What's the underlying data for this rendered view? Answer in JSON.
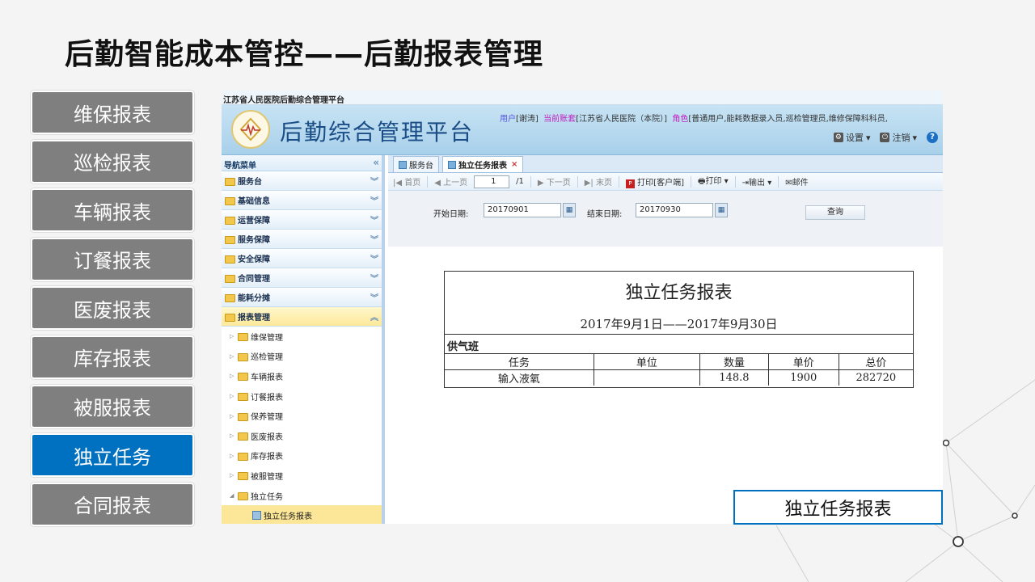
{
  "page": {
    "title": "后勤智能成本管控——后勤报表管理",
    "caption": "独立任务报表"
  },
  "slide_nav": [
    {
      "label": "维保报表",
      "active": false
    },
    {
      "label": "巡检报表",
      "active": false
    },
    {
      "label": "车辆报表",
      "active": false
    },
    {
      "label": "订餐报表",
      "active": false
    },
    {
      "label": "医废报表",
      "active": false
    },
    {
      "label": "库存报表",
      "active": false
    },
    {
      "label": "被服报表",
      "active": false
    },
    {
      "label": "独立任务",
      "active": true
    },
    {
      "label": "合同报表",
      "active": false
    }
  ],
  "app": {
    "topline": "江苏省人民医院后勤综合管理平台",
    "name": "后勤综合管理平台",
    "user": {
      "user_key": "用户",
      "user_val": "[谢涛]",
      "account_key": "当前账套",
      "account_val": "[江苏省人民医院（本院）]",
      "role_key": "角色",
      "role_val": "[普通用户,能耗数据录入员,巡检管理员,维修保障科科员,"
    },
    "tools": {
      "settings": "设置",
      "logout": "注销",
      "help": "?"
    },
    "sidebar": {
      "title": "导航菜单",
      "menus": [
        {
          "label": "服务台",
          "active": false
        },
        {
          "label": "基础信息",
          "active": false
        },
        {
          "label": "运营保障",
          "active": false
        },
        {
          "label": "服务保障",
          "active": false
        },
        {
          "label": "安全保障",
          "active": false
        },
        {
          "label": "合同管理",
          "active": false
        },
        {
          "label": "能耗分摊",
          "active": false
        },
        {
          "label": "报表管理",
          "active": true
        }
      ],
      "sub_items": [
        "维保管理",
        "巡检管理",
        "车辆报表",
        "订餐报表",
        "保养管理",
        "医废报表",
        "库存报表",
        "被服管理",
        "独立任务"
      ],
      "leaf": "独立任务报表"
    },
    "tabs": [
      {
        "label": "服务台",
        "active": false
      },
      {
        "label": "独立任务报表",
        "active": true
      }
    ],
    "toolbar": {
      "first": "首页",
      "prev": "上一页",
      "page_value": "1",
      "page_total": "/1",
      "next": "下一页",
      "last": "末页",
      "print_client": "打印[客户端]",
      "print": "打印",
      "export": "输出",
      "mail": "邮件"
    },
    "filter": {
      "start_label": "开始日期:",
      "start_value": "20170901",
      "end_label": "结束日期:",
      "end_value": "20170930",
      "query": "查询"
    },
    "report": {
      "title": "独立任务报表",
      "date_range": "2017年9月1日——2017年9月30日",
      "group": "供气班",
      "headers": [
        "任务",
        "单位",
        "数量",
        "单价",
        "总价"
      ],
      "rows": [
        [
          "输入液氧",
          "",
          "148.8",
          "1900",
          "282720"
        ]
      ]
    }
  }
}
